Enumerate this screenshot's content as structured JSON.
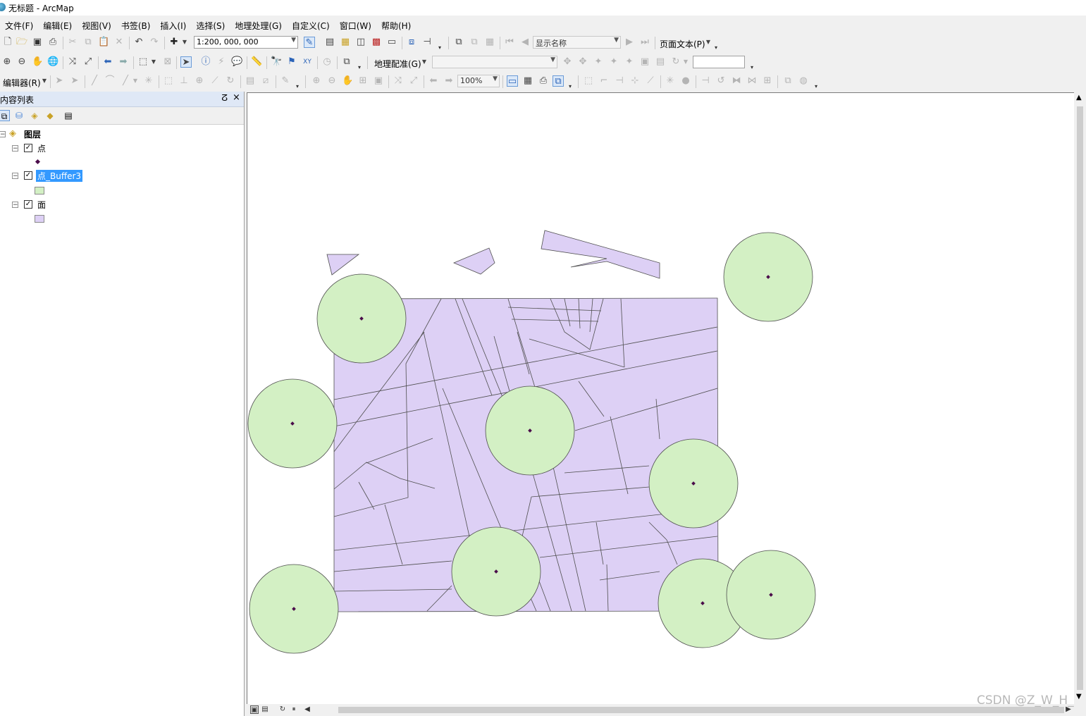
{
  "window": {
    "title": "无标题 - ArcMap"
  },
  "menu": [
    "文件(F)",
    "编辑(E)",
    "视图(V)",
    "书签(B)",
    "插入(I)",
    "选择(S)",
    "地理处理(G)",
    "自定义(C)",
    "窗口(W)",
    "帮助(H)"
  ],
  "standard_toolbar": {
    "scale": "1:200, 000, 000",
    "display_name": "显示名称",
    "page_text": "页面文本(P)"
  },
  "tools_toolbar": {
    "georeferencing": "地理配准(G)",
    "layer_combo": "",
    "text_field": ""
  },
  "editor_toolbar": {
    "editor": "编辑器(R)",
    "zoom_percent": "100%"
  },
  "toc": {
    "title": "内容列表",
    "pin": "ᵖ",
    "close": "×",
    "root": "图层",
    "layers": [
      {
        "name": "点",
        "checked": true,
        "selected": false,
        "symbol": "point",
        "color": "#4b0d4b"
      },
      {
        "name": "点_Buffer3",
        "checked": true,
        "selected": true,
        "symbol": "fill",
        "color": "#d3f0c4"
      },
      {
        "name": "面",
        "checked": true,
        "selected": false,
        "symbol": "fill",
        "color": "#ddd0f5"
      }
    ]
  },
  "colors": {
    "polygon_fill": "#ddd0f5",
    "buffer_fill": "#d3f0c4",
    "point": "#4b0d4b",
    "selection": "#3399ff"
  },
  "watermark": "CSDN @Z_W_H_"
}
